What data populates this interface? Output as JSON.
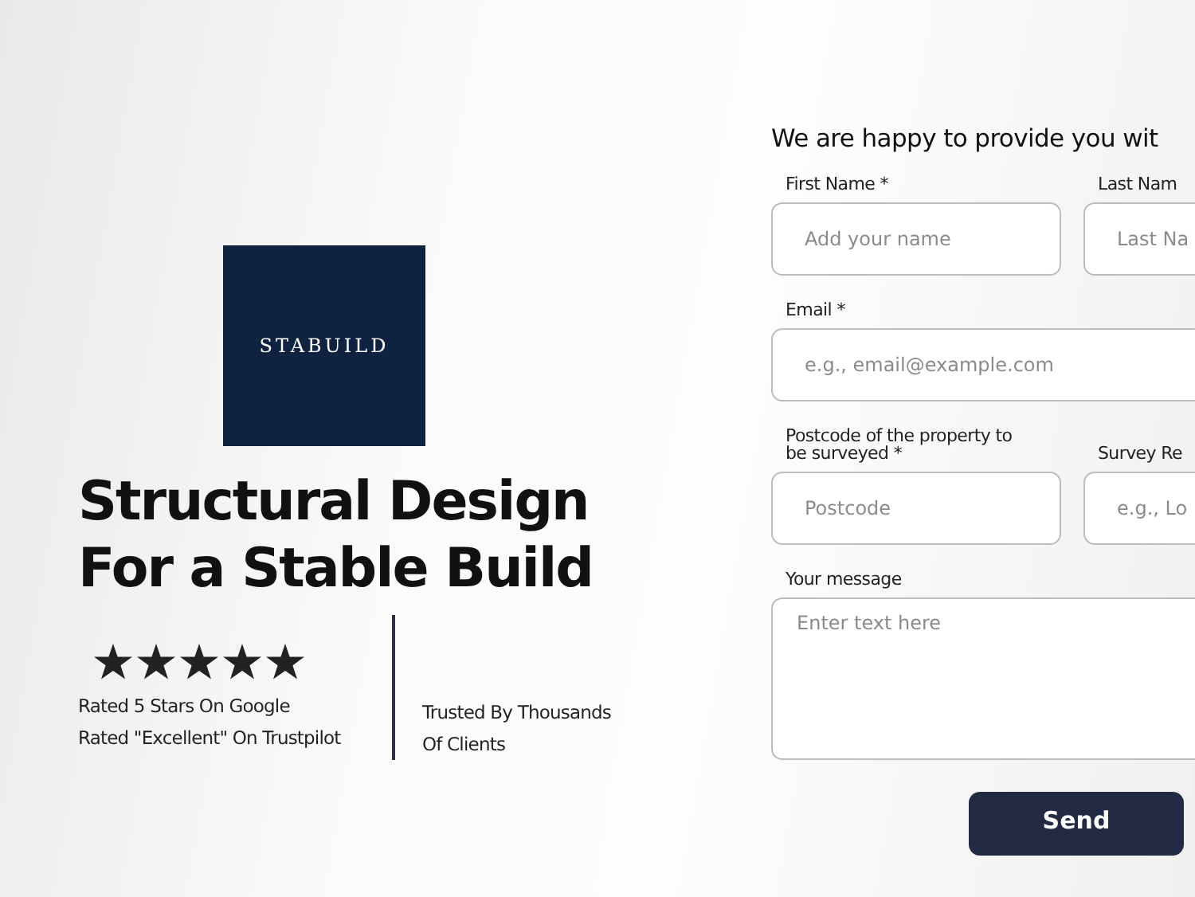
{
  "logo": {
    "text": "STABUILD"
  },
  "heading": [
    "Structural Design",
    "For a Stable Build"
  ],
  "rating": {
    "stars": 5,
    "lines": [
      "Rated 5 Stars On Google",
      "Rated \"Excellent\" On Trustpilot"
    ]
  },
  "trust": {
    "lines": [
      "Trusted By Thousands",
      "Of Clients"
    ]
  },
  "form": {
    "title": "We are happy to provide you wit",
    "rows": [
      {
        "fields": [
          {
            "label": "First Name *",
            "placeholder": "Add your name"
          },
          {
            "label": "Last Nam",
            "placeholder": "Last Na"
          }
        ]
      },
      {
        "fields": [
          {
            "label": "Email *",
            "placeholder": "e.g., email@example.com",
            "kind": "wide"
          }
        ]
      },
      {
        "fields": [
          {
            "label": "Postcode of the property to be surveyed *",
            "placeholder": "Postcode"
          },
          {
            "label": "Survey Re",
            "placeholder": "e.g., Lo"
          }
        ]
      }
    ],
    "message": {
      "label": "Your message",
      "placeholder": "Enter text here"
    },
    "button": "Send"
  }
}
